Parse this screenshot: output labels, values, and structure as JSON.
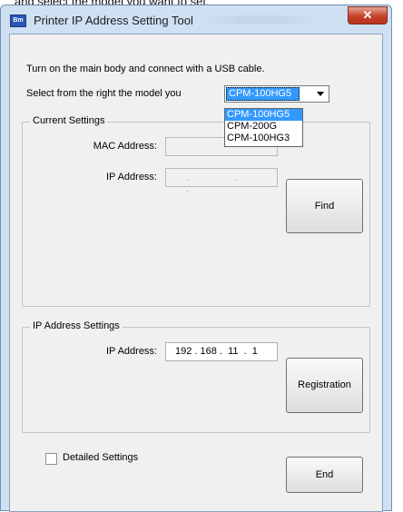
{
  "caption": "and select the model you want to set.",
  "window": {
    "title": "Printer IP Address Setting Tool",
    "icon_text": "Bm",
    "close_glyph": "✕"
  },
  "instructions": {
    "line1": "Turn on the main body and connect with a USB cable.",
    "line2": "Select from the right the model you"
  },
  "model_select": {
    "value": "CPM-100HG5",
    "options": [
      "CPM-100HG5",
      "CPM-200G",
      "CPM-100HG3"
    ]
  },
  "current_settings": {
    "title": "Current Settings",
    "mac_label": "MAC Address:",
    "mac_value": "",
    "ip_label": "IP Address:",
    "ip_dots": ". . .",
    "find_label": "Find"
  },
  "ip_settings": {
    "title": "IP Address Settings",
    "ip_label": "IP Address:",
    "ip_value": "192 . 168 .  11  .  1",
    "register_label": "Registration"
  },
  "detailed": {
    "label": "Detailed Settings",
    "checked": false
  },
  "end_label": "End",
  "colors": {
    "selection": "#3399ff",
    "close": "#c4432b"
  }
}
